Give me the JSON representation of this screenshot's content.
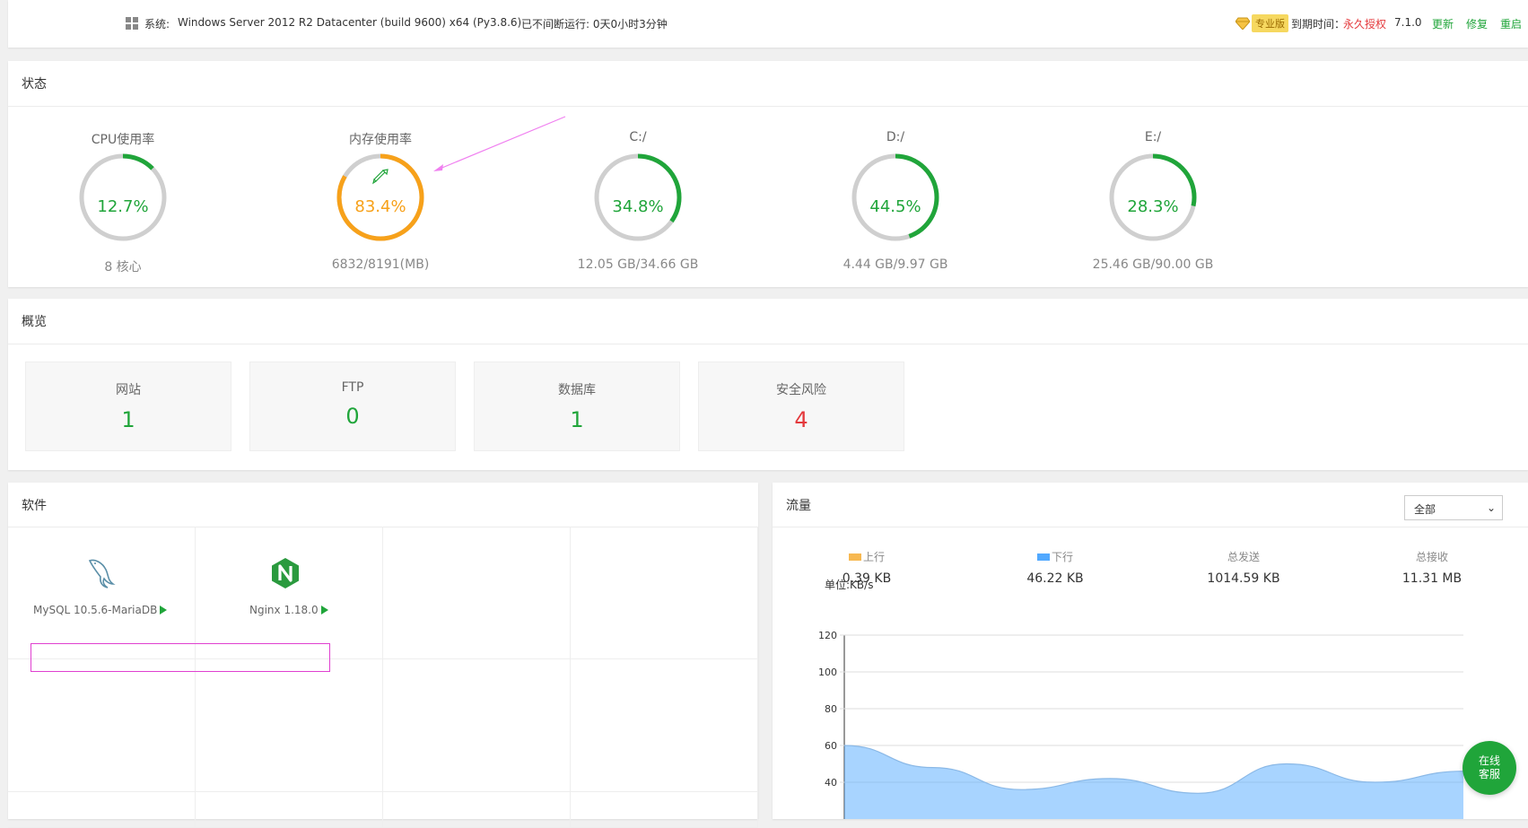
{
  "topbar": {
    "system_label": "系统:",
    "system_value": "Windows Server 2012 R2 Datacenter (build 9600) x64 (Py3.8.6)",
    "uptime": "已不间断运行: 0天0小时3分钟",
    "pro_badge": "专业版",
    "expire_label": "到期时间：",
    "expire_value": "永久授权",
    "version": "7.1.0",
    "update": "更新",
    "repair": "修复",
    "restart": "重启"
  },
  "status": {
    "title": "状态",
    "gauges": [
      {
        "title": "CPU使用率",
        "value": "12.7%",
        "sub": "8 核心",
        "percent": 12.7,
        "color": "#20a53a"
      },
      {
        "title": "内存使用率",
        "value": "83.4%",
        "sub": "6832/8191(MB)",
        "percent": 83.4,
        "color": "#f7a11a"
      },
      {
        "title": "C:/",
        "value": "34.8%",
        "sub": "12.05 GB/34.66 GB",
        "percent": 34.8,
        "color": "#20a53a"
      },
      {
        "title": "D:/",
        "value": "44.5%",
        "sub": "4.44 GB/9.97 GB",
        "percent": 44.5,
        "color": "#20a53a"
      },
      {
        "title": "E:/",
        "value": "28.3%",
        "sub": "25.46 GB/90.00 GB",
        "percent": 28.3,
        "color": "#20a53a"
      }
    ]
  },
  "overview": {
    "title": "概览",
    "items": [
      {
        "label": "网站",
        "value": "1"
      },
      {
        "label": "FTP",
        "value": "0"
      },
      {
        "label": "数据库",
        "value": "1"
      },
      {
        "label": "安全风险",
        "value": "4"
      }
    ]
  },
  "software": {
    "title": "软件",
    "items": [
      {
        "name": "MySQL 10.5.6-MariaDB",
        "icon": "mysql-dolphin-icon"
      },
      {
        "name": "Nginx 1.18.0",
        "icon": "nginx-icon"
      }
    ]
  },
  "traffic": {
    "title": "流量",
    "filter": "全部",
    "stats": [
      {
        "label": "上行",
        "value": "0.39 KB",
        "color": "#f7b851"
      },
      {
        "label": "下行",
        "value": "46.22 KB",
        "color": "#52a9ff"
      },
      {
        "label": "总发送",
        "value": "1014.59 KB"
      },
      {
        "label": "总接收",
        "value": "11.31 MB"
      }
    ],
    "unit": "单位:KB/s"
  },
  "service_button": {
    "line1": "在线",
    "line2": "客服"
  },
  "chart_data": {
    "type": "area",
    "ylabel": "单位:KB/s",
    "yticks": [
      120,
      100,
      80,
      60,
      40
    ],
    "ylim": [
      40,
      120
    ],
    "series": [
      {
        "name": "下行",
        "values": [
          60,
          48,
          36,
          42,
          34,
          50,
          40,
          46
        ]
      }
    ],
    "grid": true
  }
}
